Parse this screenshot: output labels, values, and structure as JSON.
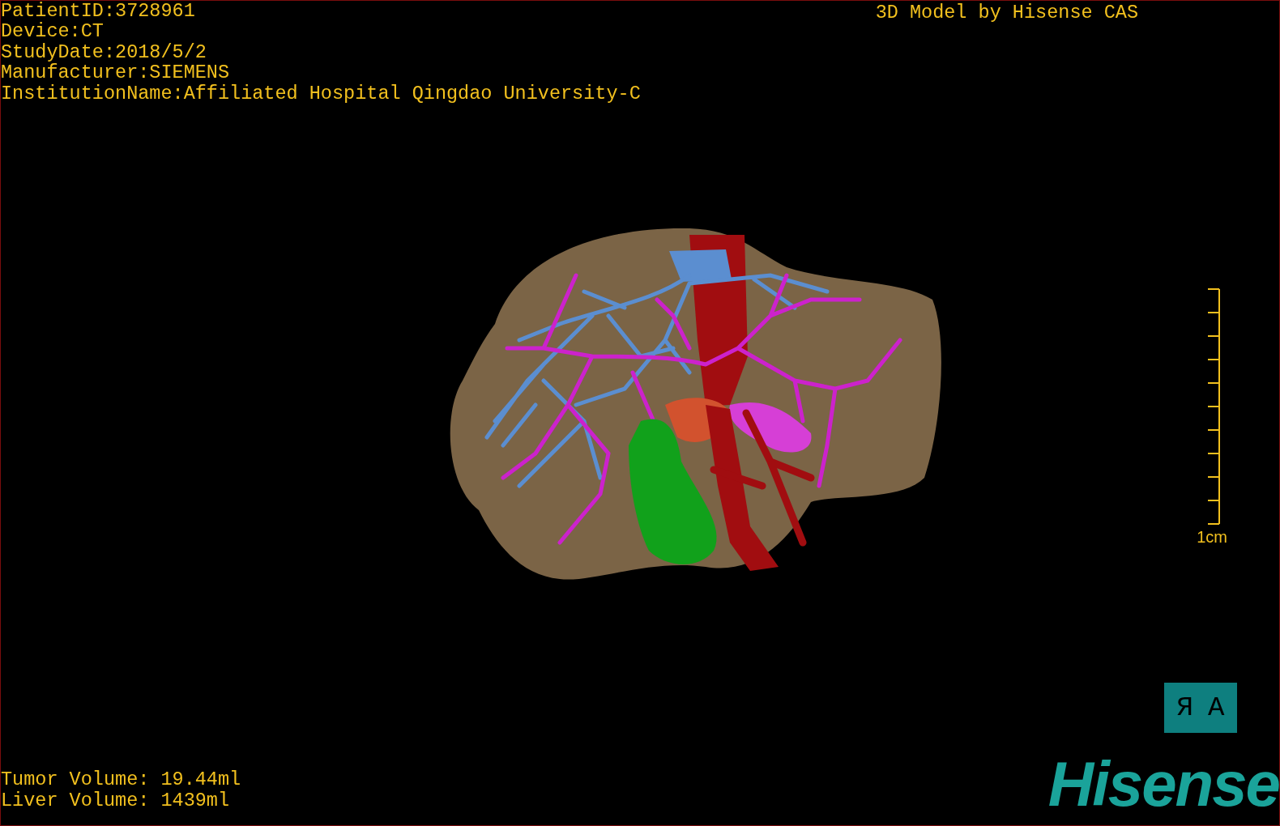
{
  "header": {
    "patient_info": [
      "PatientID:3728961",
      "Device:CT",
      "StudyDate:2018/5/2",
      "Manufacturer:SIEMENS",
      "InstitutionName:Affiliated Hospital Qingdao University-C"
    ],
    "title": "3D Model by Hisense CAS"
  },
  "scale_bar": {
    "label": "1cm"
  },
  "orientation_cube": {
    "labels": [
      "Я",
      "A"
    ]
  },
  "volumes": [
    "Tumor Volume: 19.44ml",
    "Liver Volume: 1439ml"
  ],
  "logo": {
    "text": "Hisense"
  }
}
